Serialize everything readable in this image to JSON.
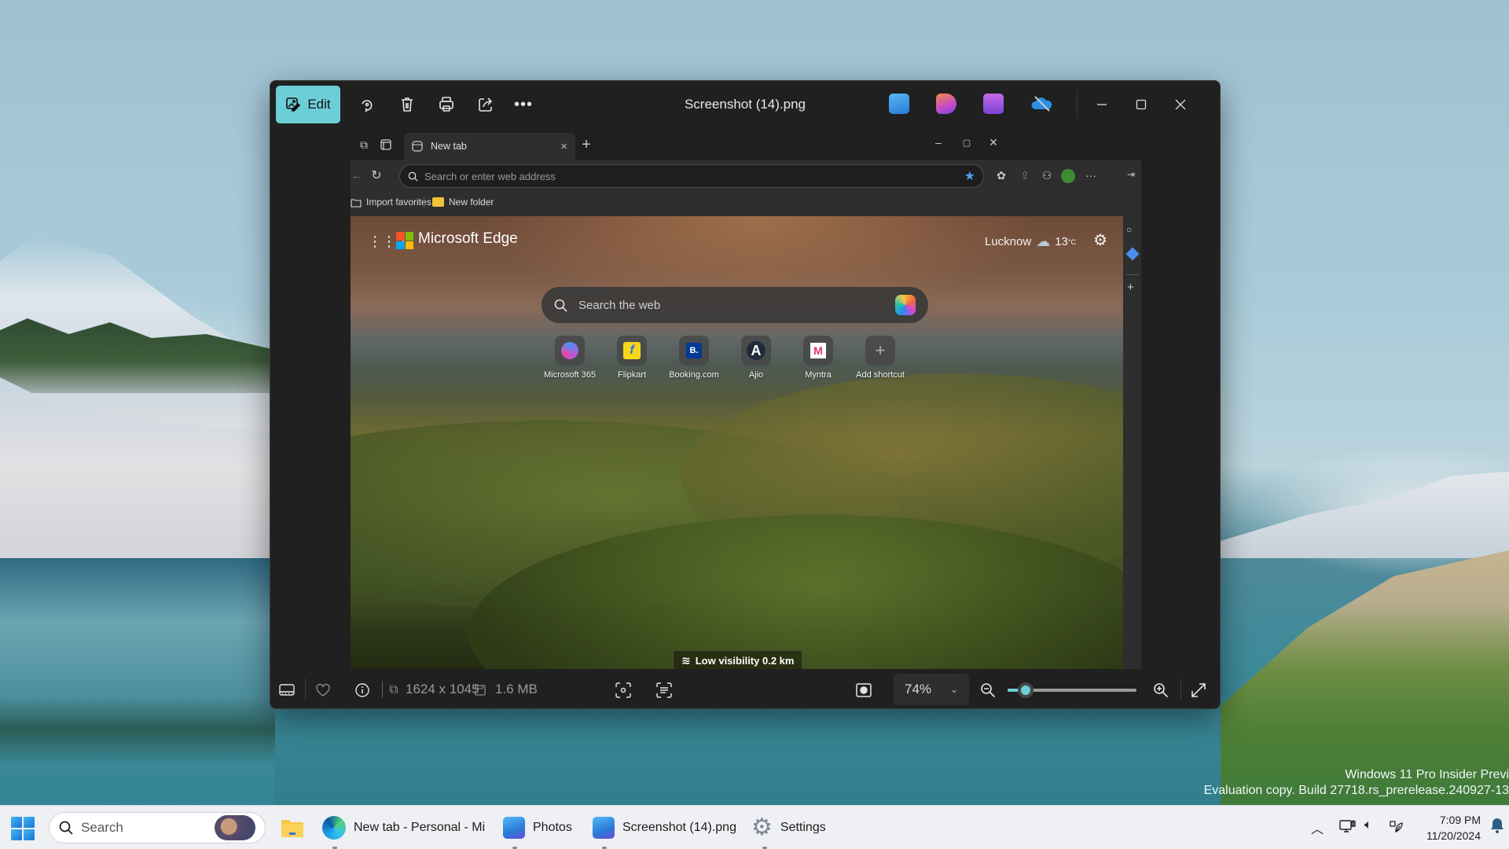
{
  "desktop": {
    "watermark": {
      "line1": "Windows 11 Pro Insider Previ",
      "line2": "Evaluation copy. Build 27718.rs_prerelease.240927-13"
    }
  },
  "photos_window": {
    "title": "Screenshot (14).png",
    "toolbar": {
      "edit_label": "Edit",
      "icons": [
        "edit-image-icon",
        "rotate-icon",
        "delete-icon",
        "print-icon",
        "share-icon",
        "more-icon"
      ]
    },
    "app_icons": [
      "photos-app-icon",
      "designer-app-icon",
      "clipchamp-app-icon",
      "onedrive-off-icon"
    ],
    "window_controls": [
      "minimize",
      "maximize",
      "close"
    ],
    "accent_color": "#6ccfd8",
    "bottom_bar": {
      "dimensions": "1624 x 1045",
      "file_size": "1.6 MB",
      "zoom_level": "74%",
      "zoom_slider_fraction": 0.14
    }
  },
  "edge_screenshot": {
    "tab_title": "New tab",
    "address_placeholder": "Search or enter web address",
    "favorites": [
      {
        "label": "Import favorites"
      },
      {
        "label": "New folder"
      }
    ],
    "ntp": {
      "brand": "Microsoft Edge",
      "city": "Lucknow",
      "temperature": "13",
      "temp_unit": "°C",
      "search_placeholder": "Search the web",
      "shortcuts": [
        {
          "label": "Microsoft 365"
        },
        {
          "label": "Flipkart"
        },
        {
          "label": "Booking.com",
          "glyph": "B."
        },
        {
          "label": "Ajio",
          "glyph": "A"
        },
        {
          "label": "Myntra",
          "glyph": "M"
        },
        {
          "label": "Add shortcut",
          "glyph": "+"
        }
      ],
      "visibility": "Low visibility 0.2 km"
    }
  },
  "taskbar": {
    "search_placeholder": "Search",
    "items": [
      {
        "label": ""
      },
      {
        "label": "New tab - Personal - Mi"
      },
      {
        "label": "Photos"
      },
      {
        "label": "Screenshot (14).png"
      },
      {
        "label": "Settings"
      }
    ],
    "time": "7:09 PM",
    "date": "11/20/2024"
  }
}
